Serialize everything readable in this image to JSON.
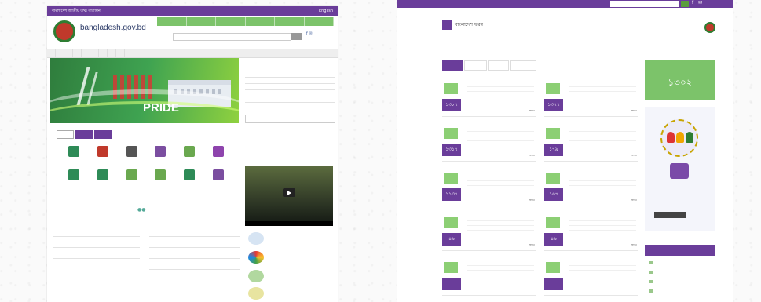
{
  "left_portal": {
    "site_name": "bangladesh.gov.bd",
    "top_links": [
      "বাংলাদেশ জাতীয় তথ্য বাতায়ন",
      "English"
    ],
    "top_tabs": [
      "",
      "",
      "",
      "",
      "",
      ""
    ],
    "search_placeholder": "",
    "social": "f ✉",
    "nav_items": [
      "",
      "",
      "",
      "",
      "",
      "",
      "",
      "",
      ""
    ],
    "banner_text": "PRIDE",
    "service_tabs": [
      "",
      "",
      ""
    ],
    "icon_labels": [
      "",
      "",
      "",
      "",
      "",
      "",
      "",
      "",
      "",
      "",
      "",
      ""
    ],
    "icon_colors": [
      "#2e8b57",
      "#c0392b",
      "#555555",
      "#7b4ea0",
      "#6aa84f",
      "#8e44ad",
      "#2e8b57",
      "#2e8b57",
      "#6aa84f",
      "#6aa84f",
      "#2e8b57",
      "#7b4ea0"
    ],
    "news_left_title": "",
    "news_right_title": "",
    "news_rows_left": [
      "",
      "",
      "",
      "",
      ""
    ],
    "news_rows_right": [
      "",
      "",
      "",
      "",
      "",
      "",
      "",
      ""
    ],
    "side_title": "",
    "side_rows": [
      "",
      "",
      "",
      "",
      "",
      ""
    ],
    "side_sub1": "",
    "side_sub2": ""
  },
  "right_portal": {
    "site_title": "বাংলাদেশ ফরম",
    "site_sub": "",
    "search_placeholder": "",
    "tabs": [
      "",
      "",
      "",
      ""
    ],
    "cards": [
      {
        "title": "",
        "badge": "১৩৮৭",
        "more": "আরও"
      },
      {
        "title": "",
        "badge": "১৩৭৭",
        "more": "আরও"
      },
      {
        "title": "",
        "badge": "১৩১৭",
        "more": "আরও"
      },
      {
        "title": "",
        "badge": "১৭৯",
        "more": "আরও"
      },
      {
        "title": "",
        "badge": "১১৩৭",
        "more": "আরও"
      },
      {
        "title": "",
        "badge": "১৬৭",
        "more": "আরও"
      },
      {
        "title": "",
        "badge": "৪৯",
        "more": "আরও"
      },
      {
        "title": "",
        "badge": "৪৯",
        "more": "আরও"
      },
      {
        "title": "",
        "badge": "",
        "more": ""
      },
      {
        "title": "",
        "badge": "",
        "more": ""
      }
    ],
    "green_box_top": "",
    "green_box_number": "১৩০২",
    "important_title": "",
    "important_links": [
      "",
      "",
      "",
      ""
    ]
  }
}
